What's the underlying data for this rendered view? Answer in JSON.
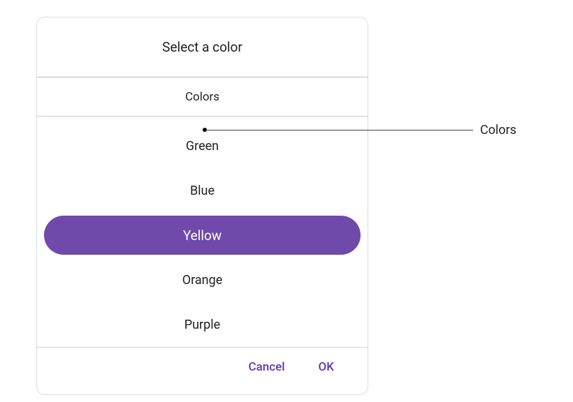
{
  "dialog": {
    "title": "Select a color",
    "subheader": "Colors",
    "items": [
      {
        "label": "Green",
        "selected": false
      },
      {
        "label": "Blue",
        "selected": false
      },
      {
        "label": "Yellow",
        "selected": true
      },
      {
        "label": "Orange",
        "selected": false
      },
      {
        "label": "Purple",
        "selected": false
      }
    ],
    "cancel": "Cancel",
    "ok": "OK"
  },
  "annotations": {
    "colors_callout": "Colors"
  },
  "colors": {
    "primary": "#6f4aab"
  }
}
